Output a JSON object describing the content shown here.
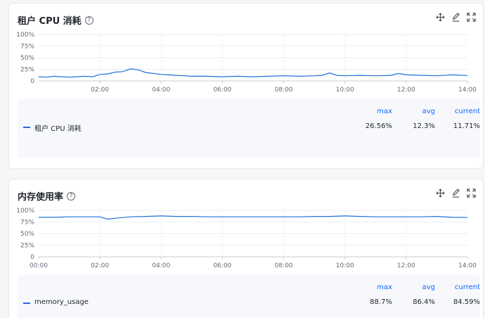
{
  "panels": [
    {
      "title": "租户 CPU 消耗",
      "help_icon": "question-circle-icon",
      "y_ticks": [
        "100%",
        "75%",
        "50%",
        "25%",
        "0"
      ],
      "x_ticks": [
        "02:00",
        "04:00",
        "06:00",
        "08:00",
        "10:00",
        "12:00",
        "14:00"
      ],
      "legend": {
        "headers": {
          "max": "max",
          "avg": "avg",
          "current": "current"
        },
        "series": [
          {
            "name": "租户 CPU 消耗",
            "max": "26.56%",
            "avg": "12.3%",
            "current": "11.71%"
          }
        ]
      }
    },
    {
      "title": "内存使用率",
      "help_icon": "question-circle-icon",
      "y_ticks": [
        "100%",
        "75%",
        "50%",
        "25%",
        "0"
      ],
      "x_ticks": [
        "00:00",
        "02:00",
        "04:00",
        "06:00",
        "08:00",
        "10:00",
        "12:00",
        "14:00"
      ],
      "legend": {
        "headers": {
          "max": "max",
          "avg": "avg",
          "current": "current"
        },
        "series": [
          {
            "name": "memory_usage",
            "max": "88.7%",
            "avg": "86.4%",
            "current": "84.59%"
          }
        ]
      }
    }
  ],
  "toolbar_icons": [
    "drag-move-icon",
    "edit-icon",
    "fullscreen-icon"
  ],
  "colors": {
    "series": "#1f6fd9",
    "accent": "#1664ff",
    "grid": "#eceef1"
  },
  "chart_data": [
    {
      "type": "line",
      "x_range_hours": [
        0,
        14
      ],
      "ylim": [
        0,
        100
      ],
      "series": [
        {
          "name": "租户 CPU 消耗",
          "x": [
            0,
            0.25,
            0.5,
            0.75,
            1,
            1.25,
            1.5,
            1.75,
            2,
            2.25,
            2.5,
            2.75,
            3,
            3.25,
            3.5,
            3.75,
            4,
            4.25,
            4.5,
            4.75,
            5,
            5.5,
            6,
            6.5,
            7,
            7.5,
            8,
            8.5,
            9,
            9.25,
            9.5,
            9.75,
            10,
            10.5,
            11,
            11.5,
            11.75,
            12,
            12.5,
            13,
            13.5,
            14
          ],
          "values": [
            9,
            8,
            10,
            9,
            8,
            9,
            10,
            9,
            14,
            15,
            19,
            20,
            26,
            24,
            18,
            16,
            14,
            13,
            12,
            11,
            10,
            10,
            9,
            10,
            9,
            10,
            11,
            10,
            11,
            12,
            17,
            12,
            11,
            12,
            11,
            12,
            16,
            13,
            12,
            11,
            13,
            11.7
          ]
        }
      ]
    },
    {
      "type": "line",
      "x_range_hours": [
        0,
        14
      ],
      "ylim": [
        0,
        100
      ],
      "series": [
        {
          "name": "memory_usage",
          "x": [
            0,
            0.5,
            1,
            1.5,
            2,
            2.25,
            2.5,
            3,
            3.5,
            4,
            4.5,
            5,
            5.5,
            6,
            6.5,
            7,
            7.5,
            8,
            8.5,
            9,
            9.5,
            10,
            10.5,
            11,
            11.5,
            12,
            12.5,
            13,
            13.5,
            14
          ],
          "values": [
            85,
            85,
            86,
            86,
            86,
            81,
            83,
            86,
            87,
            88,
            87,
            87,
            86,
            86,
            86,
            86,
            86,
            86,
            86,
            87,
            87,
            88,
            87,
            86,
            86,
            86,
            86,
            87,
            85,
            84.6
          ]
        }
      ]
    }
  ]
}
